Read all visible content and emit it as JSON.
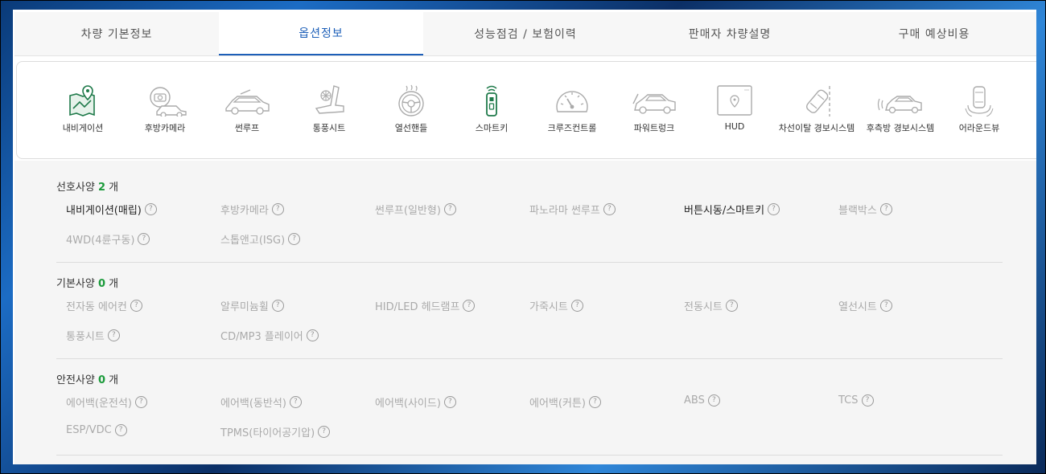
{
  "tabs": [
    {
      "label": "차량 기본정보"
    },
    {
      "label": "옵션정보"
    },
    {
      "label": "성능점검 / 보험이력"
    },
    {
      "label": "판매자 차량설명"
    },
    {
      "label": "구매 예상비용"
    }
  ],
  "options": [
    {
      "label": "내비게이션",
      "icon": "navigation-map-icon",
      "color": "#1f7a4a"
    },
    {
      "label": "후방카메라",
      "icon": "rear-camera-icon",
      "color": "#999999"
    },
    {
      "label": "썬루프",
      "icon": "sunroof-icon",
      "color": "#999999"
    },
    {
      "label": "통풍시트",
      "icon": "ventilated-seat-icon",
      "color": "#999999"
    },
    {
      "label": "열선핸들",
      "icon": "heated-steering-icon",
      "color": "#999999"
    },
    {
      "label": "스마트키",
      "icon": "smart-key-icon",
      "color": "#1f7a4a"
    },
    {
      "label": "크루즈컨트롤",
      "icon": "cruise-control-icon",
      "color": "#999999"
    },
    {
      "label": "파워트렁크",
      "icon": "power-trunk-icon",
      "color": "#999999"
    },
    {
      "label": "HUD",
      "icon": "hud-icon",
      "color": "#999999"
    },
    {
      "label": "차선이탈 경보시스템",
      "icon": "lane-departure-icon",
      "color": "#999999"
    },
    {
      "label": "후측방 경보시스템",
      "icon": "blind-spot-icon",
      "color": "#999999"
    },
    {
      "label": "어라운드뷰",
      "icon": "around-view-icon",
      "color": "#999999"
    }
  ],
  "sections": [
    {
      "title": "선호사양",
      "count": "2",
      "unit": "개",
      "items": [
        {
          "label": "내비게이션(매립)",
          "on": true
        },
        {
          "label": "후방카메라",
          "on": false
        },
        {
          "label": "썬루프(일반형)",
          "on": false
        },
        {
          "label": "파노라마 썬루프",
          "on": false
        },
        {
          "label": "버튼시동/스마트키",
          "on": true
        },
        {
          "label": "블랙박스",
          "on": false
        },
        {
          "label": "4WD(4륜구동)",
          "on": false
        },
        {
          "label": "스톱앤고(ISG)",
          "on": false
        }
      ]
    },
    {
      "title": "기본사양",
      "count": "0",
      "unit": "개",
      "items": [
        {
          "label": "전자동 에어컨",
          "on": false
        },
        {
          "label": "알루미늄휠",
          "on": false
        },
        {
          "label": "HID/LED 헤드램프",
          "on": false
        },
        {
          "label": "가죽시트",
          "on": false
        },
        {
          "label": "전동시트",
          "on": false
        },
        {
          "label": "열선시트",
          "on": false
        },
        {
          "label": "통풍시트",
          "on": false
        },
        {
          "label": "CD/MP3 플레이어",
          "on": false
        }
      ]
    },
    {
      "title": "안전사양",
      "count": "0",
      "unit": "개",
      "items": [
        {
          "label": "에어백(운전석)",
          "on": false
        },
        {
          "label": "에어백(동반석)",
          "on": false
        },
        {
          "label": "에어백(사이드)",
          "on": false
        },
        {
          "label": "에어백(커튼)",
          "on": false
        },
        {
          "label": "ABS",
          "on": false
        },
        {
          "label": "TCS",
          "on": false
        },
        {
          "label": "ESP/VDC",
          "on": false
        },
        {
          "label": "TPMS(타이어공기압)",
          "on": false
        }
      ]
    }
  ],
  "help_glyph": "?"
}
